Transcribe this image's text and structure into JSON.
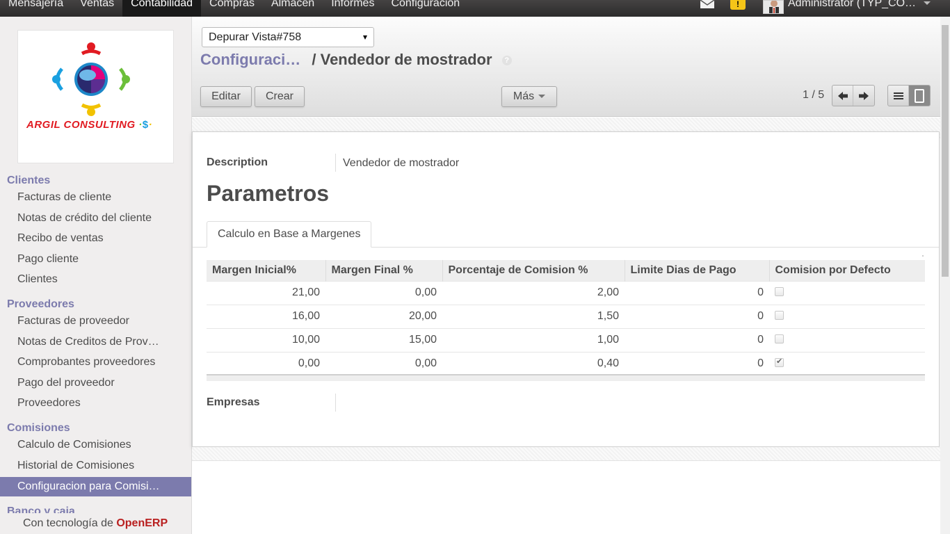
{
  "topnav": {
    "items": [
      "Mensajería",
      "Ventas",
      "Contabilidad",
      "Compras",
      "Almacén",
      "Informes",
      "Configuración"
    ],
    "active_index": 2,
    "user": "Administrator (TYP_CO…"
  },
  "sidebar": {
    "logo_text": "ARGIL CONSULTING",
    "sections": [
      {
        "title": "Clientes",
        "items": [
          "Facturas de cliente",
          "Notas de crédito del cliente",
          "Recibo de ventas",
          "Pago cliente",
          "Clientes"
        ]
      },
      {
        "title": "Proveedores",
        "items": [
          "Facturas de proveedor",
          "Notas de Creditos de Prov…",
          "Comprobantes proveedores",
          "Pago del proveedor",
          "Proveedores"
        ]
      },
      {
        "title": "Comisiones",
        "items": [
          "Calculo de Comisiones",
          "Historial de Comisiones",
          "Configuracion para Comisi…"
        ]
      },
      {
        "title": "Banco y caja",
        "items": []
      }
    ],
    "active_item": "Configuracion para Comisi…",
    "powered_prefix": "Con tecnología de",
    "powered_brand": "OpenERP"
  },
  "header": {
    "view_select": "Depurar Vista#758",
    "breadcrumb_link": "Configuraci…",
    "breadcrumb_sep": "/",
    "breadcrumb_current": "Vendedor de mostrador",
    "help": "?",
    "edit_label": "Editar",
    "create_label": "Crear",
    "more_label": "Más",
    "pager": "1 / 5"
  },
  "form": {
    "description_label": "Description",
    "description_value": "Vendedor de mostrador",
    "title": "Parametros",
    "tab_label": "Calculo en Base a Margenes",
    "columns": [
      "Margen Inicial%",
      "Margen Final %",
      "Porcentaje de Comision %",
      "Limite Dias de Pago",
      "Comision por Defecto"
    ],
    "rows": [
      {
        "inicial": "21,00",
        "final": "0,00",
        "porcentaje": "2,00",
        "dias": "0",
        "defecto": false
      },
      {
        "inicial": "16,00",
        "final": "20,00",
        "porcentaje": "1,50",
        "dias": "0",
        "defecto": false
      },
      {
        "inicial": "10,00",
        "final": "15,00",
        "porcentaje": "1,00",
        "dias": "0",
        "defecto": false
      },
      {
        "inicial": "0,00",
        "final": "0,00",
        "porcentaje": "0,40",
        "dias": "0",
        "defecto": true
      }
    ],
    "empresas_label": "Empresas"
  },
  "colors": {
    "accent": "#7c7bad",
    "brand_red": "#b92020",
    "topbar": "#2b2b2b"
  }
}
